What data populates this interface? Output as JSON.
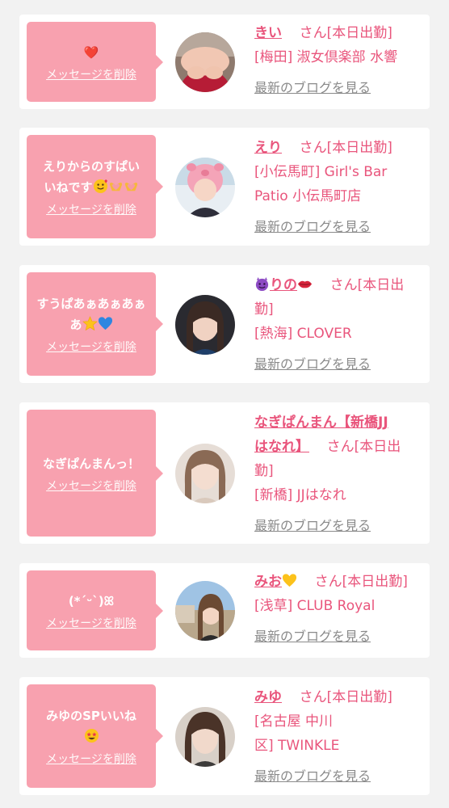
{
  "delete_label": "メッセージを削除",
  "blog_label": "最新のブログを見る",
  "status_suffix": "さん[本日出勤]",
  "entries": [
    {
      "message": "❤️",
      "name": "きい",
      "shop": "[梅田] 淑女倶楽部 水響",
      "avatar_icon": "profile-photo"
    },
    {
      "message_line1": "えりからのすぱい",
      "message_line2": "いねです",
      "message_emojis": [
        "smiling-hearts-emoji",
        "heart-hands-emoji",
        "heart-hands-emoji"
      ],
      "name": "えり",
      "shop_line1": "[小伝馬町] Girl's Bar",
      "shop_line2": "Patio 小伝馬町店",
      "avatar_icon": "profile-photo"
    },
    {
      "message_line1": "すうぱあぁあぁあぁ",
      "message_line2": "あ",
      "message_emojis": [
        "star-emoji",
        "blue-heart-emoji"
      ],
      "name": "りの",
      "name_emojis": [
        "devil-emoji",
        "lips-emoji"
      ],
      "status_line1": "さん[本日出",
      "status_line2": "勤]",
      "shop": "[熱海] CLOVER",
      "avatar_icon": "profile-photo"
    },
    {
      "message": "なぎぱんまんっ！",
      "name_line1": "なぎぱんまん【新橋JJ",
      "name_line2": "はなれ】",
      "status_line1": "さん[本日出",
      "status_line2": "勤]",
      "shop": "[新橋] JJはなれ",
      "avatar_icon": "profile-photo"
    },
    {
      "message": "(*ˊᵕˋ)ꕤ",
      "name": "みお",
      "name_emojis": [
        "yellow-heart-emoji"
      ],
      "shop": "[浅草] CLUB Royal",
      "avatar_icon": "profile-photo"
    },
    {
      "message_line1": "みゆのSPいいね",
      "message_emojis": [
        "star-struck-emoji"
      ],
      "name": "みゆ",
      "shop_line1": "[名古屋 中川",
      "shop_line2": "区] TWINKLE",
      "avatar_icon": "profile-photo"
    }
  ],
  "colors": {
    "bubble": "#f8a1af",
    "accent": "#e9557c",
    "link_gray": "#8a8a8a",
    "card": "#ffffff",
    "background": "#f2f2f2"
  }
}
